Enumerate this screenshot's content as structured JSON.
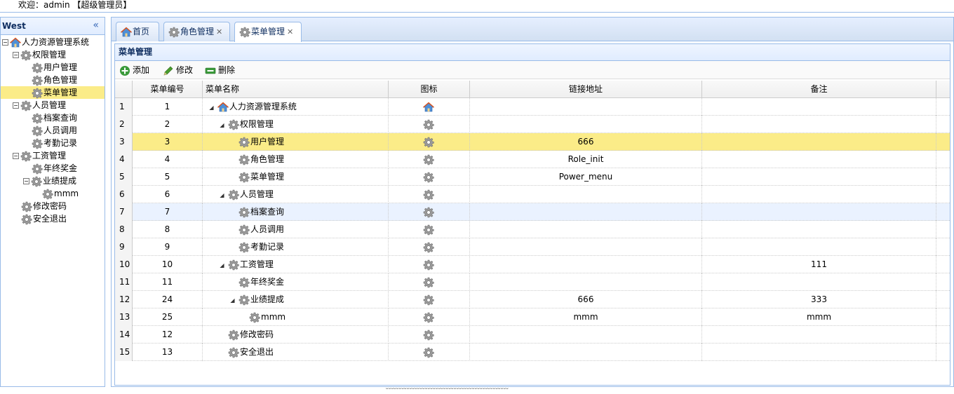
{
  "header": {
    "welcome": "欢迎：admin 【超级管理员】"
  },
  "west": {
    "title": "West",
    "tree": [
      {
        "label": "人力资源管理系统",
        "icon": "home-icon",
        "level": 0,
        "toggle": "⊟"
      },
      {
        "label": "权限管理",
        "icon": "gear-icon",
        "level": 1,
        "toggle": "⊟"
      },
      {
        "label": "用户管理",
        "icon": "gear-icon",
        "level": 2
      },
      {
        "label": "角色管理",
        "icon": "gear-icon",
        "level": 2
      },
      {
        "label": "菜单管理",
        "icon": "gear-icon",
        "level": 2,
        "selected": true
      },
      {
        "label": "人员管理",
        "icon": "gear-icon",
        "level": 1,
        "toggle": "⊟"
      },
      {
        "label": "档案查询",
        "icon": "gear-icon",
        "level": 2
      },
      {
        "label": "人员调用",
        "icon": "gear-icon",
        "level": 2
      },
      {
        "label": "考勤记录",
        "icon": "gear-icon",
        "level": 2
      },
      {
        "label": "工资管理",
        "icon": "gear-icon",
        "level": 1,
        "toggle": "⊟"
      },
      {
        "label": "年终奖金",
        "icon": "gear-icon",
        "level": 2
      },
      {
        "label": "业绩提成",
        "icon": "gear-icon",
        "level": 2,
        "toggle": "⊟"
      },
      {
        "label": "mmm",
        "icon": "gear-icon",
        "level": 3
      },
      {
        "label": "修改密码",
        "icon": "gear-icon",
        "level": 1
      },
      {
        "label": "安全退出",
        "icon": "gear-icon",
        "level": 1
      }
    ]
  },
  "tabs": [
    {
      "label": "首页",
      "icon": "home-icon",
      "closable": false
    },
    {
      "label": "角色管理",
      "icon": "gear-icon",
      "closable": true
    },
    {
      "label": "菜单管理",
      "icon": "gear-icon",
      "closable": true,
      "active": true
    }
  ],
  "panel": {
    "title": "菜单管理"
  },
  "toolbar": {
    "add": "添加",
    "edit": "修改",
    "delete": "删除"
  },
  "grid": {
    "columns": [
      "菜单编号",
      "菜单名称",
      "图标",
      "链接地址",
      "备注"
    ],
    "rows": [
      {
        "n": "1",
        "id": "1",
        "name": "人力资源管理系统",
        "icon": "home-icon",
        "depth": 0,
        "expander": "◢",
        "url": "",
        "note": ""
      },
      {
        "n": "2",
        "id": "2",
        "name": "权限管理",
        "icon": "gear-icon",
        "depth": 1,
        "expander": "◢",
        "url": "",
        "note": ""
      },
      {
        "n": "3",
        "id": "3",
        "name": "用户管理",
        "icon": "gear-icon",
        "depth": 2,
        "url": "666",
        "note": "",
        "selected": true
      },
      {
        "n": "4",
        "id": "4",
        "name": "角色管理",
        "icon": "gear-icon",
        "depth": 2,
        "url": "Role_init",
        "note": ""
      },
      {
        "n": "5",
        "id": "5",
        "name": "菜单管理",
        "icon": "gear-icon",
        "depth": 2,
        "url": "Power_menu",
        "note": ""
      },
      {
        "n": "6",
        "id": "6",
        "name": "人员管理",
        "icon": "gear-icon",
        "depth": 1,
        "expander": "◢",
        "url": "",
        "note": ""
      },
      {
        "n": "7",
        "id": "7",
        "name": "档案查询",
        "icon": "gear-icon",
        "depth": 2,
        "url": "",
        "note": "",
        "hover": true
      },
      {
        "n": "8",
        "id": "8",
        "name": "人员调用",
        "icon": "gear-icon",
        "depth": 2,
        "url": "",
        "note": ""
      },
      {
        "n": "9",
        "id": "9",
        "name": "考勤记录",
        "icon": "gear-icon",
        "depth": 2,
        "url": "",
        "note": ""
      },
      {
        "n": "10",
        "id": "10",
        "name": "工资管理",
        "icon": "gear-icon",
        "depth": 1,
        "expander": "◢",
        "url": "",
        "note": "111"
      },
      {
        "n": "11",
        "id": "11",
        "name": "年终奖金",
        "icon": "gear-icon",
        "depth": 2,
        "url": "",
        "note": ""
      },
      {
        "n": "12",
        "id": "24",
        "name": "业绩提成",
        "icon": "gear-icon",
        "depth": 2,
        "expander": "◢",
        "url": "666",
        "note": "333"
      },
      {
        "n": "13",
        "id": "25",
        "name": "mmm",
        "icon": "gear-icon",
        "depth": 3,
        "url": "mmm",
        "note": "mmm"
      },
      {
        "n": "14",
        "id": "12",
        "name": "修改密码",
        "icon": "gear-icon",
        "depth": 1,
        "url": "",
        "note": ""
      },
      {
        "n": "15",
        "id": "13",
        "name": "安全退出",
        "icon": "gear-icon",
        "depth": 1,
        "url": "",
        "note": ""
      }
    ]
  },
  "footer": {
    "dots": "ᵕᵕᵕᵕᵕᵕᵕᵕᵕᵕᵕᵕᵕᵕᵕᵕᵕᵕᵕᵕᵕᵕᵕᵕᵕᵕᵕᵕᵕᵕᵕᵕᵕᵕᵕᵕᵕᵕᵕᵕᵕᵕᵕᵕᵕᵕᵕ"
  },
  "colors": {
    "border": "#99bbe8",
    "selected": "#fbec88",
    "hover": "#eaf2ff",
    "title": "#0e2d5f"
  }
}
